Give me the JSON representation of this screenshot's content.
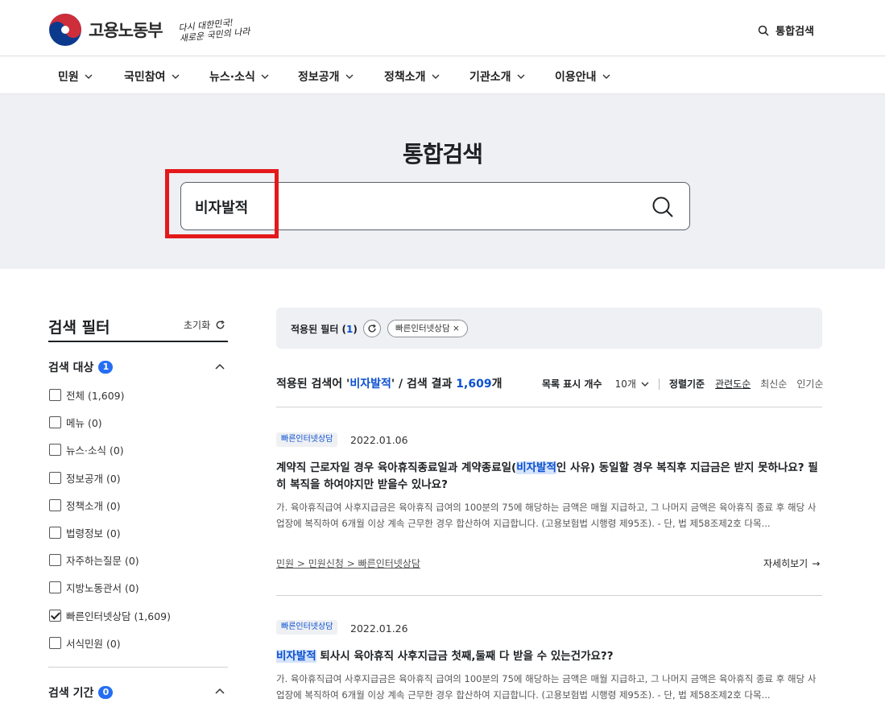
{
  "header": {
    "logo_text": "고용노동부",
    "slogan_line1": "다시 대한민국!",
    "slogan_line2": "새로운 국민의 나라",
    "search_label": "통합검색"
  },
  "nav": {
    "items": [
      "민원",
      "국민참여",
      "뉴스·소식",
      "정보공개",
      "정책소개",
      "기관소개",
      "이용안내"
    ]
  },
  "hero": {
    "title": "통합검색",
    "search_value": "비자발적"
  },
  "sidebar": {
    "title": "검색 필터",
    "reset_label": "초기화",
    "target_section": {
      "title": "검색 대상",
      "badge": "1",
      "options": [
        {
          "label": "전체 (1,609)",
          "checked": false
        },
        {
          "label": "메뉴 (0)",
          "checked": false
        },
        {
          "label": "뉴스·소식 (0)",
          "checked": false
        },
        {
          "label": "정보공개 (0)",
          "checked": false
        },
        {
          "label": "정책소개 (0)",
          "checked": false
        },
        {
          "label": "법령정보 (0)",
          "checked": false
        },
        {
          "label": "자주하는질문 (0)",
          "checked": false
        },
        {
          "label": "지방노동관서 (0)",
          "checked": false
        },
        {
          "label": "빠른인터넷상담 (1,609)",
          "checked": true
        },
        {
          "label": "서식민원 (0)",
          "checked": false
        }
      ]
    },
    "period_section": {
      "title": "검색 기간",
      "badge": "0"
    }
  },
  "filter_bar": {
    "label_prefix": "적용된 필터 (",
    "count": "1",
    "label_suffix": ")",
    "chip": "빠른인터넷상담 ×"
  },
  "results_header": {
    "prefix": "적용된 검색어 '",
    "keyword": "비자발적",
    "middle": "' / 검색 결과 ",
    "count": "1,609",
    "suffix": "개",
    "page_size_label": "목록 표시 개수",
    "page_size_value": "10개",
    "sort_label": "정렬기준",
    "sort_options": [
      "관련도순",
      "최신순",
      "인기순"
    ],
    "active_sort": "관련도순"
  },
  "results": [
    {
      "tag": "빠른인터넷상담",
      "date": "2022.01.06",
      "title_before": "계약직 근로자일 경우 육아휴직종료일과 계약종료일(",
      "title_highlight": "비자발적",
      "title_after": "인 사유) 동일할 경우 복직후 지급금은 받지 못하나요? 필히 복직을 하여야지만 받을수 있나요?",
      "description": "가. 육아휴직급여 사후지급금은 육아휴직 급여의 100분의 75에 해당하는 금액은 매월 지급하고, 그 나머지 금액은 육아휴직 종료 후 해당 사업장에 복직하여 6개월 이상 계속 근무한 경우 합산하여 지급합니다. (고용보험법 시행령 제95조). - 단, 법 제58조제2호 다목...",
      "path": "민원 > 민원신청 > 빠른인터넷상담",
      "more": "자세히보기"
    },
    {
      "tag": "빠른인터넷상담",
      "date": "2022.01.26",
      "title_before": "",
      "title_highlight": "비자발적",
      "title_after": " 퇴사시 육아휴직 사후지급금 첫째,둘째 다 받을 수 있는건가요??",
      "description": "가. 육아휴직급여 사후지급금은 육아휴직 급여의 100분의 75에 해당하는 금액은 매월 지급하고, 그 나머지 금액은 육아휴직 종료 후 해당 사업장에 복직하여 6개월 이상 계속 근무한 경우 합산하여 지급합니다. (고용보험법 시행령 제95조). - 단, 법 제58조제2호 다목..."
    }
  ],
  "colors": {
    "accent": "#0b50d0",
    "badge": "#256ef4",
    "highlight_box": "#e3191b",
    "hero_bg": "#eef0f4"
  }
}
